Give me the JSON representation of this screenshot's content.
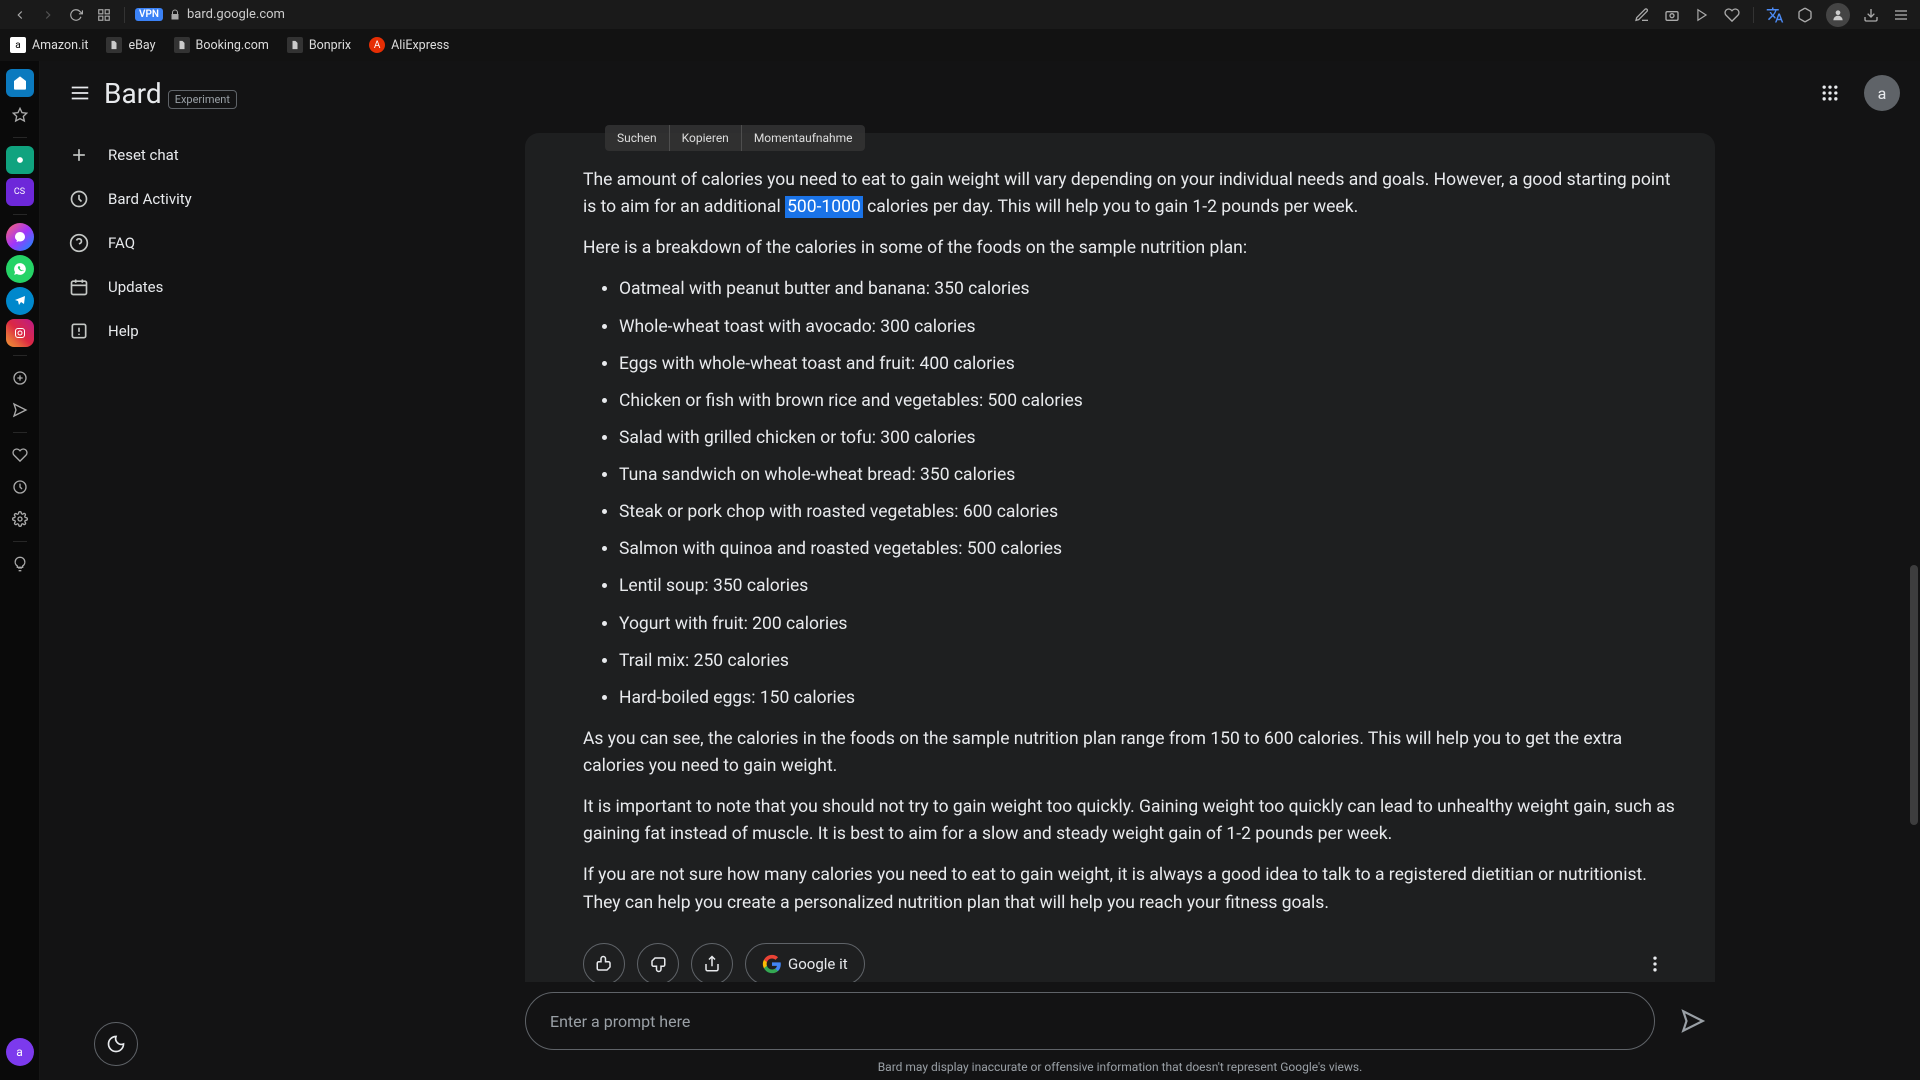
{
  "browser": {
    "url": "bard.google.com",
    "vpn_badge": "VPN",
    "bookmarks": [
      {
        "label": "Amazon.it",
        "color": "#111"
      },
      {
        "label": "eBay",
        "color": "#555"
      },
      {
        "label": "Booking.com",
        "color": "#555"
      },
      {
        "label": "Bonprix",
        "color": "#555"
      },
      {
        "label": "AliExpress",
        "color": "#e62e04"
      }
    ]
  },
  "context_menu": {
    "items": [
      "Suchen",
      "Kopieren",
      "Momentaufnahme"
    ]
  },
  "bard": {
    "logo": "Bard",
    "experiment_label": "Experiment",
    "avatar_letter": "a",
    "sidebar": {
      "items": [
        {
          "icon": "plus",
          "label": "Reset chat"
        },
        {
          "icon": "activity",
          "label": "Bard Activity"
        },
        {
          "icon": "help-circle",
          "label": "FAQ"
        },
        {
          "icon": "calendar",
          "label": "Updates"
        },
        {
          "icon": "alert",
          "label": "Help"
        }
      ]
    },
    "response": {
      "intro_before": "The amount of calories you need to eat to gain weight will vary depending on your individual needs and goals. However, a good starting point is to aim for an additional ",
      "highlighted": "500-1000",
      "intro_after": " calories per day. This will help you to gain 1-2 pounds per week.",
      "breakdown_heading": "Here is a breakdown of the calories in some of the foods on the sample nutrition plan:",
      "foods": [
        "Oatmeal with peanut butter and banana: 350 calories",
        "Whole-wheat toast with avocado: 300 calories",
        "Eggs with whole-wheat toast and fruit: 400 calories",
        "Chicken or fish with brown rice and vegetables: 500 calories",
        "Salad with grilled chicken or tofu: 300 calories",
        "Tuna sandwich on whole-wheat bread: 350 calories",
        "Steak or pork chop with roasted vegetables: 600 calories",
        "Salmon with quinoa and roasted vegetables: 500 calories",
        "Lentil soup: 350 calories",
        "Yogurt with fruit: 200 calories",
        "Trail mix: 250 calories",
        "Hard-boiled eggs: 150 calories"
      ],
      "summary": "As you can see, the calories in the foods on the sample nutrition plan range from 150 to 600 calories. This will help you to get the extra calories you need to gain weight.",
      "note": "It is important to note that you should not try to gain weight too quickly. Gaining weight too quickly can lead to unhealthy weight gain, such as gaining fat instead of muscle. It is best to aim for a slow and steady weight gain of 1-2 pounds per week.",
      "advice": "If you are not sure how many calories you need to eat to gain weight, it is always a good idea to talk to a registered dietitian or nutritionist. They can help you create a personalized nutrition plan that will help you reach your fitness goals."
    },
    "actions": {
      "google_it": "Google it"
    },
    "prompt": {
      "placeholder": "Enter a prompt here"
    },
    "disclaimer": "Bard may display inaccurate or offensive information that doesn't represent Google's views."
  }
}
